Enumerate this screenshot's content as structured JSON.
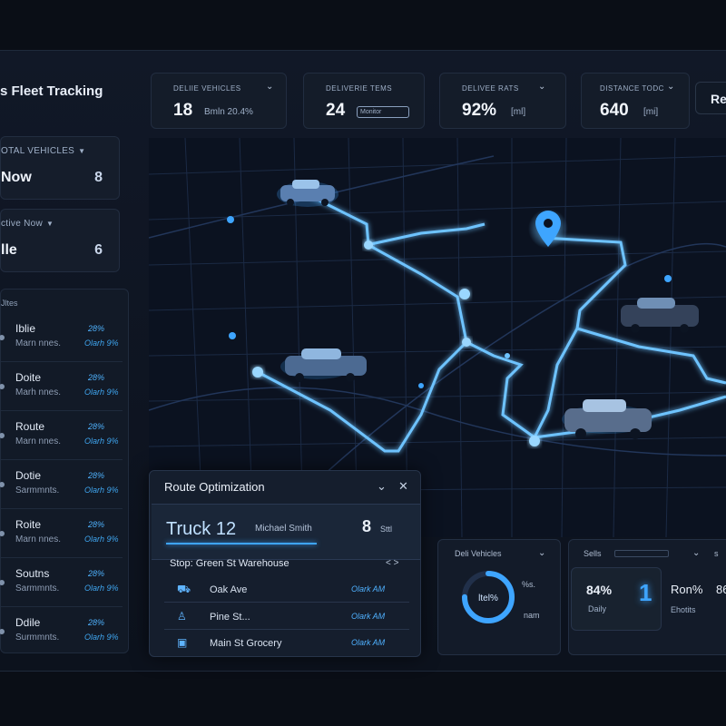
{
  "app": {
    "title": "s Fleet Tracking"
  },
  "side_cards": [
    {
      "label": "OTAL VEHICLES",
      "value_label": "Now",
      "value": "8"
    },
    {
      "label": "ctive Now",
      "value_label": "lle",
      "value": "6"
    }
  ],
  "route_list": {
    "heading": "Jltes",
    "items": [
      {
        "title": "Iblie",
        "subtitle": "Marn nnes.",
        "v1": "28%",
        "v2": "Olarh 9%"
      },
      {
        "title": "Doite",
        "subtitle": "Marh nnes.",
        "v1": "28%",
        "v2": "Olarh 9%"
      },
      {
        "title": "Route",
        "subtitle": "Marn nnes.",
        "v1": "28%",
        "v2": "Olarh 9%"
      },
      {
        "title": "Dotie",
        "subtitle": "Sarmmnts.",
        "v1": "28%",
        "v2": "Olarh 9%"
      },
      {
        "title": "Roite",
        "subtitle": "Marn nnes.",
        "v1": "28%",
        "v2": "Olarh 9%"
      },
      {
        "title": "Soutns",
        "subtitle": "Sarmmnts.",
        "v1": "28%",
        "v2": "Olarh 9%"
      },
      {
        "title": "Ddile",
        "subtitle": "Surmmnts.",
        "v1": "28%",
        "v2": "Olarh 9%"
      }
    ]
  },
  "stats": [
    {
      "label": "DELIIE VEHICLES",
      "value": "18",
      "sub": "Bmln 20.4%"
    },
    {
      "label": "DELIVERIE TEMS",
      "value": "24",
      "pill": "Monitor"
    },
    {
      "label": "DELIVEE RATS",
      "value": "92%",
      "sub": "[ml]"
    },
    {
      "label": "DISTANCE TODC",
      "value": "640",
      "sub": "[mi]"
    }
  ],
  "refresh_label": "Re",
  "route_panel": {
    "title": "Route Optimization",
    "chevron": "⌄",
    "close": "✕",
    "truck": "Truck 12",
    "driver": "Michael Smith",
    "stops_count": "8",
    "stops_unit": "Sttl",
    "stop_head": "Stop: Green St Warehouse",
    "stop_head_arrows": "<  >",
    "stops": [
      {
        "icon": "⛟",
        "name": "Oak Ave",
        "time": "Olark AM"
      },
      {
        "icon": "♙",
        "name": "Pine St...",
        "time": "Olark AM"
      },
      {
        "icon": "▣",
        "name": "Main St Grocery",
        "time": "Olark AM"
      }
    ]
  },
  "bottom_left": {
    "label": "Deli Vehicles",
    "gauge_text": "ltel%",
    "gauge_value": 0.75,
    "side_top": "%s.",
    "side_bottom": "nam"
  },
  "bottom_right": {
    "label": "Sells",
    "pct": "84%",
    "pct_sub": "Daily",
    "big_num": "1",
    "right_label": "Ron%",
    "right_sub": "Ehotits",
    "far": "86",
    "far_label": "s"
  },
  "colors": {
    "accent": "#3ea5ff",
    "route_glow": "#6ec3ff",
    "background": "#0a0e16"
  }
}
